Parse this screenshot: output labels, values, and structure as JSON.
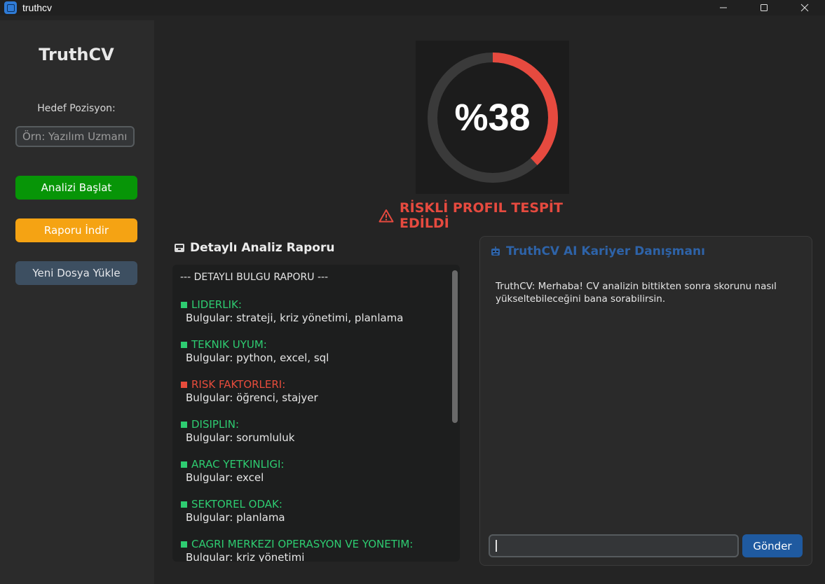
{
  "window": {
    "title": "truthcv"
  },
  "sidebar": {
    "logo": "TruthCV",
    "position_label": "Hedef Pozisyon:",
    "position_placeholder": "Örn: Yazılım Uzmanı",
    "buttons": {
      "analyze": "Analizi Başlat",
      "report": "Raporu İndir",
      "upload": "Yeni Dosya Yükle"
    },
    "colors": {
      "analyze": "#079507",
      "report": "#f5a313",
      "upload": "#3d4f61"
    }
  },
  "score": {
    "text": "%38",
    "value": 38,
    "arc_color": "#e64a3f"
  },
  "status": {
    "text": "RİSKLİ PROFIL TESPİT EDİLDİ",
    "icon": "warning-icon",
    "color": "#e64a3f"
  },
  "report": {
    "heading": "Detaylı Analiz Raporu",
    "header_line": "--- DETAYLI BULGU RAPORU ---",
    "findings": [
      {
        "category": "LIDERLIK:",
        "detail": "Bulgular: strateji, kriz yönetimi, planlama",
        "color": "#2ecc71"
      },
      {
        "category": "TEKNIK UYUM:",
        "detail": "Bulgular: python, excel, sql",
        "color": "#2ecc71"
      },
      {
        "category": "RISK FAKTORLERI:",
        "detail": "Bulgular: öğrenci, stajyer",
        "color": "#e74c3c"
      },
      {
        "category": "DISIPLIN:",
        "detail": "Bulgular: sorumluluk",
        "color": "#2ecc71"
      },
      {
        "category": "ARAC YETKINLIGI:",
        "detail": "Bulgular: excel",
        "color": "#2ecc71"
      },
      {
        "category": "SEKTOREL ODAK:",
        "detail": "Bulgular: planlama",
        "color": "#2ecc71"
      },
      {
        "category": "CAGRI MERKEZI OPERASYON VE YONETIM:",
        "detail": "Bulgular: kriz yönetimi",
        "color": "#2ecc71"
      }
    ]
  },
  "chat": {
    "title": "TruthCV AI Kariyer Danışmanı",
    "message": "TruthCV: Merhaba! CV analizin bittikten sonra skorunu nasıl yükseltebileceğini bana sorabilirsin.",
    "input_value": "",
    "send_label": "Gönder"
  }
}
